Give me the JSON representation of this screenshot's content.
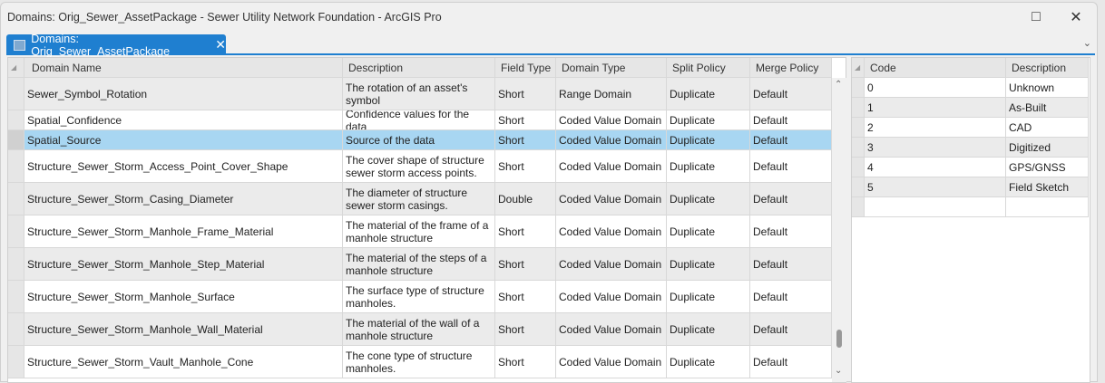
{
  "window": {
    "title": "Domains: Orig_Sewer_AssetPackage - Sewer Utility Network Foundation - ArcGIS Pro",
    "maximize_icon": "□",
    "close_icon": "✕"
  },
  "tab": {
    "label": "Domains: Orig_Sewer_AssetPackage",
    "close_icon": "✕",
    "overflow_icon": "⌄"
  },
  "domains": {
    "columns": [
      "Domain Name",
      "Description",
      "Field Type",
      "Domain Type",
      "Split Policy",
      "Merge Policy"
    ],
    "rows": [
      {
        "name": "Sewer_Symbol_Rotation",
        "description": "The rotation of an asset's symbol",
        "field_type": "Short",
        "domain_type": "Range Domain",
        "split": "Duplicate",
        "merge": "Default"
      },
      {
        "name": "Spatial_Confidence",
        "description": "Confidence values for the data",
        "field_type": "Short",
        "domain_type": "Coded Value Domain",
        "split": "Duplicate",
        "merge": "Default"
      },
      {
        "name": "Spatial_Source",
        "description": "Source of the data",
        "field_type": "Short",
        "domain_type": "Coded Value Domain",
        "split": "Duplicate",
        "merge": "Default"
      },
      {
        "name": "Structure_Sewer_Storm_Access_Point_Cover_Shape",
        "description": "The cover shape of structure sewer storm access points.",
        "field_type": "Short",
        "domain_type": "Coded Value Domain",
        "split": "Duplicate",
        "merge": "Default"
      },
      {
        "name": "Structure_Sewer_Storm_Casing_Diameter",
        "description": "The diameter of structure sewer storm casings.",
        "field_type": "Double",
        "domain_type": "Coded Value Domain",
        "split": "Duplicate",
        "merge": "Default"
      },
      {
        "name": "Structure_Sewer_Storm_Manhole_Frame_Material",
        "description": "The material of the frame of a manhole structure",
        "field_type": "Short",
        "domain_type": "Coded Value Domain",
        "split": "Duplicate",
        "merge": "Default"
      },
      {
        "name": "Structure_Sewer_Storm_Manhole_Step_Material",
        "description": "The material of the steps of a manhole structure",
        "field_type": "Short",
        "domain_type": "Coded Value Domain",
        "split": "Duplicate",
        "merge": "Default"
      },
      {
        "name": "Structure_Sewer_Storm_Manhole_Surface",
        "description": "The surface type of structure manholes.",
        "field_type": "Short",
        "domain_type": "Coded Value Domain",
        "split": "Duplicate",
        "merge": "Default"
      },
      {
        "name": "Structure_Sewer_Storm_Manhole_Wall_Material",
        "description": "The material of the wall of a manhole structure",
        "field_type": "Short",
        "domain_type": "Coded Value Domain",
        "split": "Duplicate",
        "merge": "Default"
      },
      {
        "name": "Structure_Sewer_Storm_Vault_Manhole_Cone",
        "description": "The cone type of structure manholes.",
        "field_type": "Short",
        "domain_type": "Coded Value Domain",
        "split": "Duplicate",
        "merge": "Default"
      }
    ],
    "selected_index": 2
  },
  "codes": {
    "columns": [
      "Code",
      "Description"
    ],
    "rows": [
      {
        "code": "0",
        "description": "Unknown"
      },
      {
        "code": "1",
        "description": "As-Built"
      },
      {
        "code": "2",
        "description": "CAD"
      },
      {
        "code": "3",
        "description": "Digitized"
      },
      {
        "code": "4",
        "description": "GPS/GNSS"
      },
      {
        "code": "5",
        "description": "Field Sketch"
      }
    ]
  }
}
